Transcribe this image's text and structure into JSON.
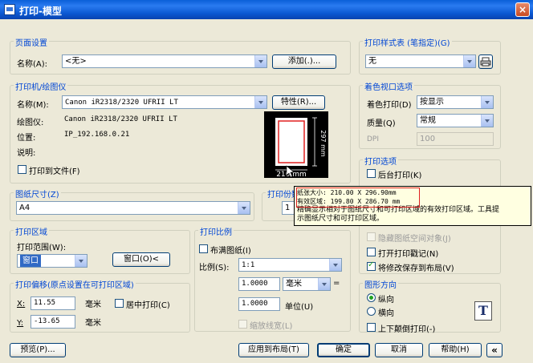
{
  "window": {
    "title": "打印-模型",
    "close": "×"
  },
  "page_setup": {
    "legend": "页面设置",
    "name_label": "名称(A):",
    "name_value": "<无>",
    "add_button": "添加(.)..."
  },
  "plot_style": {
    "legend": "打印样式表 (笔指定)(G)",
    "value": "无"
  },
  "printer": {
    "legend": "打印机/绘图仪",
    "name_label": "名称(M):",
    "name_value": "Canon iR2318/2320 UFRII LT",
    "properties_button": "特性(R)...",
    "plotter_label": "绘图仪:",
    "plotter_value": "Canon iR2318/2320 UFRII LT",
    "location_label": "位置:",
    "location_value": "IP_192.168.0.21",
    "description_label": "说明:",
    "plot_to_file": "打印到文件(F)"
  },
  "preview": {
    "height_dim": "297 mm",
    "width_dim": "210 mm"
  },
  "shaded_viewport": {
    "legend": "着色视口选项",
    "shade_label": "着色打印(D)",
    "shade_value": "按显示",
    "quality_label": "质量(Q)",
    "quality_value": "常规",
    "dpi_label": "DPI",
    "dpi_value": "100"
  },
  "plot_options": {
    "legend": "打印选项",
    "background": "后台打印(K)",
    "hide_paperspace": "隐藏图纸空间对象(J)",
    "plot_stamp": "打开打印戳记(N)",
    "save_changes": "将修改保存到布局(V)"
  },
  "paper_size": {
    "legend": "图纸尺寸(Z)",
    "value": "A4"
  },
  "copies": {
    "legend": "打印份数",
    "value": "1"
  },
  "plot_area": {
    "legend": "打印区域",
    "range_label": "打印范围(W):",
    "range_value": "窗口",
    "window_button": "窗口(O)<"
  },
  "plot_scale": {
    "legend": "打印比例",
    "fit_paper": "布满图纸(I)",
    "scale_label": "比例(S):",
    "scale_value": "1:1",
    "value1": "1.0000",
    "unit_value": "毫米",
    "equals": "=",
    "value2": "1.0000",
    "unit_label": "单位(U)",
    "scale_lineweights": "缩放线宽(L)"
  },
  "plot_offset": {
    "legend": "打印偏移(原点设置在可打印区域)",
    "x_label": "X:",
    "x_value": "11.55",
    "x_unit": "毫米",
    "center": "居中打印(C)",
    "y_label": "Y:",
    "y_value": "-13.65",
    "y_unit": "毫米"
  },
  "orientation": {
    "legend": "图形方向",
    "portrait": "纵向",
    "landscape": "横向",
    "upside_down": "上下颠倒打印(-)",
    "icon_letter": "T"
  },
  "tooltip": {
    "line1": "纸张大小: 210.00 X 296.90mm",
    "line2": "有效区域: 199.80 X 286.70 mm",
    "line3": "精确显示相对于图纸尺寸和可打印区域的有效打印区域。工具提",
    "line4": "示图纸尺寸和可打印区域。"
  },
  "footer": {
    "preview_button": "预览(P)...",
    "apply_button": "应用到布局(T)",
    "ok_button": "确定",
    "cancel_button": "取消",
    "help_button": "帮助(H)",
    "collapse_button": "«"
  },
  "colors": {
    "accent": "#0046D5",
    "title_bar": "#0A5FD8",
    "highlight": "#316AC5",
    "preview_border": "#E02020"
  }
}
